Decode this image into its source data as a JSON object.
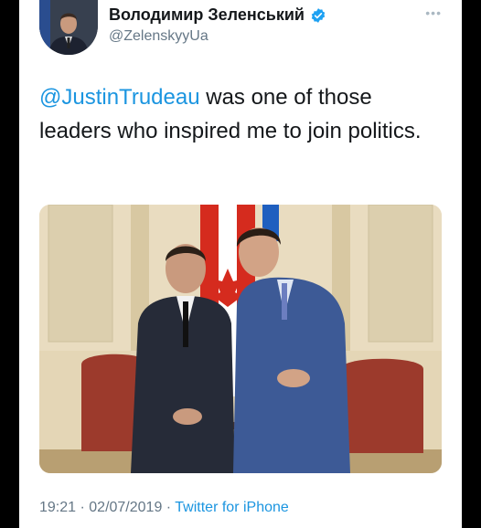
{
  "author": {
    "display_name": "Володимир Зеленський",
    "handle": "@ZelenskyyUa",
    "verified": true
  },
  "tweet": {
    "mention": "@JustinTrudeau",
    "text": " was one of those leaders who inspired me to join politics."
  },
  "footer": {
    "time": "19:21",
    "separator1": " · ",
    "date": "02/07/2019",
    "separator2": " · ",
    "source": "Twitter for iPhone"
  },
  "colors": {
    "link": "#1b95e0",
    "verified_badge": "#1da1f2",
    "secondary_text": "#657786"
  },
  "icons": {
    "verified": "verified-badge-icon",
    "more": "more-options-icon"
  }
}
